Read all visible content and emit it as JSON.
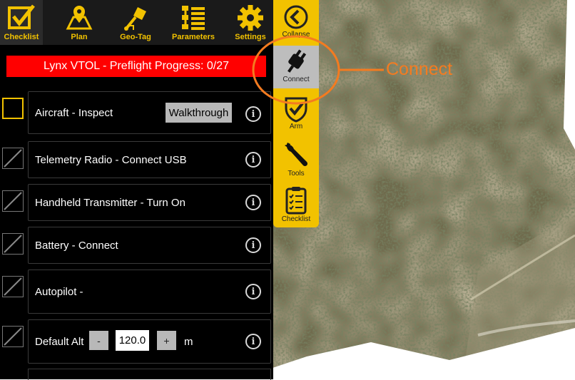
{
  "topbar": {
    "items": [
      {
        "label": "Checklist",
        "icon": "checklist-check-icon"
      },
      {
        "label": "Plan",
        "icon": "map-pin-icon"
      },
      {
        "label": "Geo-Tag",
        "icon": "geotag-pin-icon"
      },
      {
        "label": "Parameters",
        "icon": "parameters-list-icon"
      },
      {
        "label": "Settings",
        "icon": "gear-icon"
      }
    ]
  },
  "progress": {
    "text": "Lynx VTOL -  Preflight Progress: 0/27"
  },
  "checklist": {
    "rows": [
      {
        "label": "Aircraft - Inspect",
        "button": "Walkthrough"
      },
      {
        "label": "Telemetry Radio - Connect USB"
      },
      {
        "label": "Handheld Transmitter - Turn On"
      },
      {
        "label": "Battery - Connect"
      },
      {
        "label": "Autopilot -"
      },
      {
        "label": "Default Alt",
        "minus": "-",
        "value": "120.0",
        "plus": "+",
        "unit": "m"
      }
    ]
  },
  "toolbar": {
    "items": [
      {
        "label": "Collapse",
        "icon": "collapse-chevron-icon"
      },
      {
        "label": "Connect",
        "icon": "plug-icon"
      },
      {
        "label": "Arm",
        "icon": "shield-check-icon"
      },
      {
        "label": "Tools",
        "icon": "wrench-icon"
      },
      {
        "label": "Checklist",
        "icon": "clipboard-icon"
      }
    ]
  },
  "annotation": {
    "text": "Connect",
    "color": "#f47b20"
  },
  "colors": {
    "accent": "#f2c200",
    "progress_bg": "#ff0000"
  }
}
